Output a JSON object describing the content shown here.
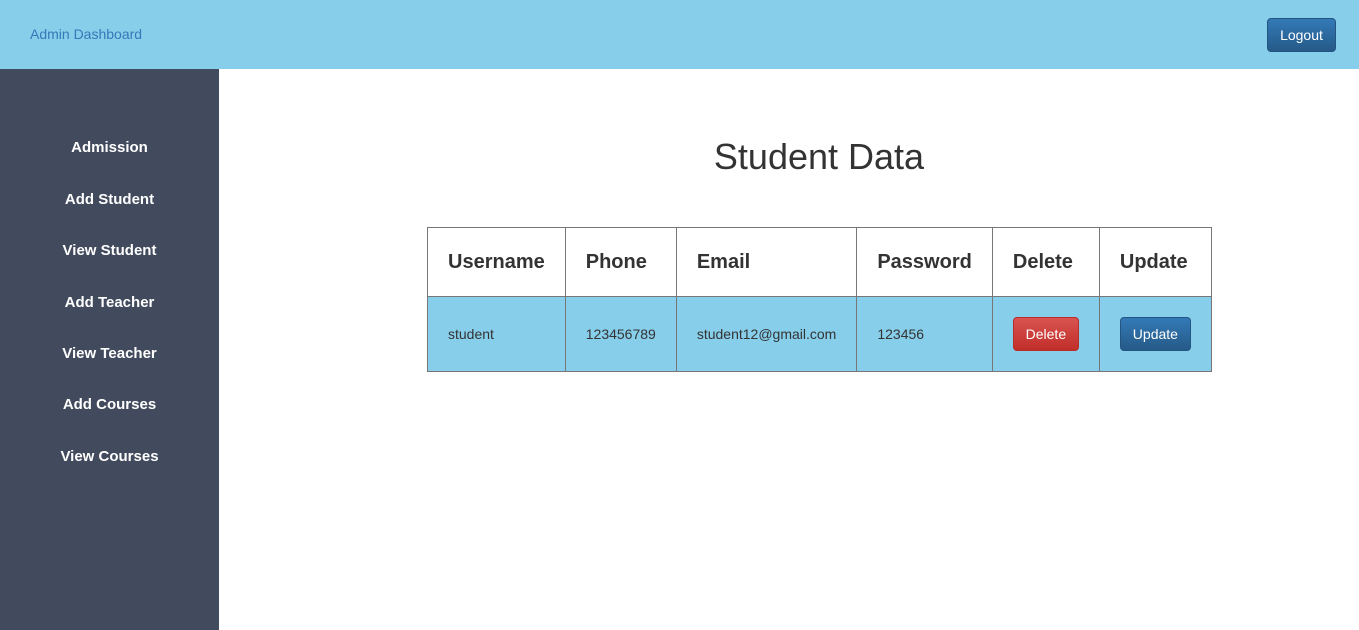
{
  "header": {
    "brand": "Admin Dashboard",
    "logout_label": "Logout"
  },
  "sidebar": {
    "items": [
      {
        "label": "Admission"
      },
      {
        "label": "Add Student"
      },
      {
        "label": "View Student"
      },
      {
        "label": "Add Teacher"
      },
      {
        "label": "View Teacher"
      },
      {
        "label": "Add Courses"
      },
      {
        "label": "View Courses"
      }
    ]
  },
  "main": {
    "title": "Student Data",
    "table": {
      "headers": [
        "Username",
        "Phone",
        "Email",
        "Password",
        "Delete",
        "Update"
      ],
      "rows": [
        {
          "username": "student",
          "phone": "123456789",
          "email": "student12@gmail.com",
          "password": "123456",
          "delete_label": "Delete",
          "update_label": "Update"
        }
      ]
    }
  },
  "colors": {
    "header_bg": "#87ceeb",
    "sidebar_bg": "#424a5d",
    "primary_button": "#337ab7",
    "danger_button": "#d9534f",
    "row_bg": "#87ceeb"
  }
}
